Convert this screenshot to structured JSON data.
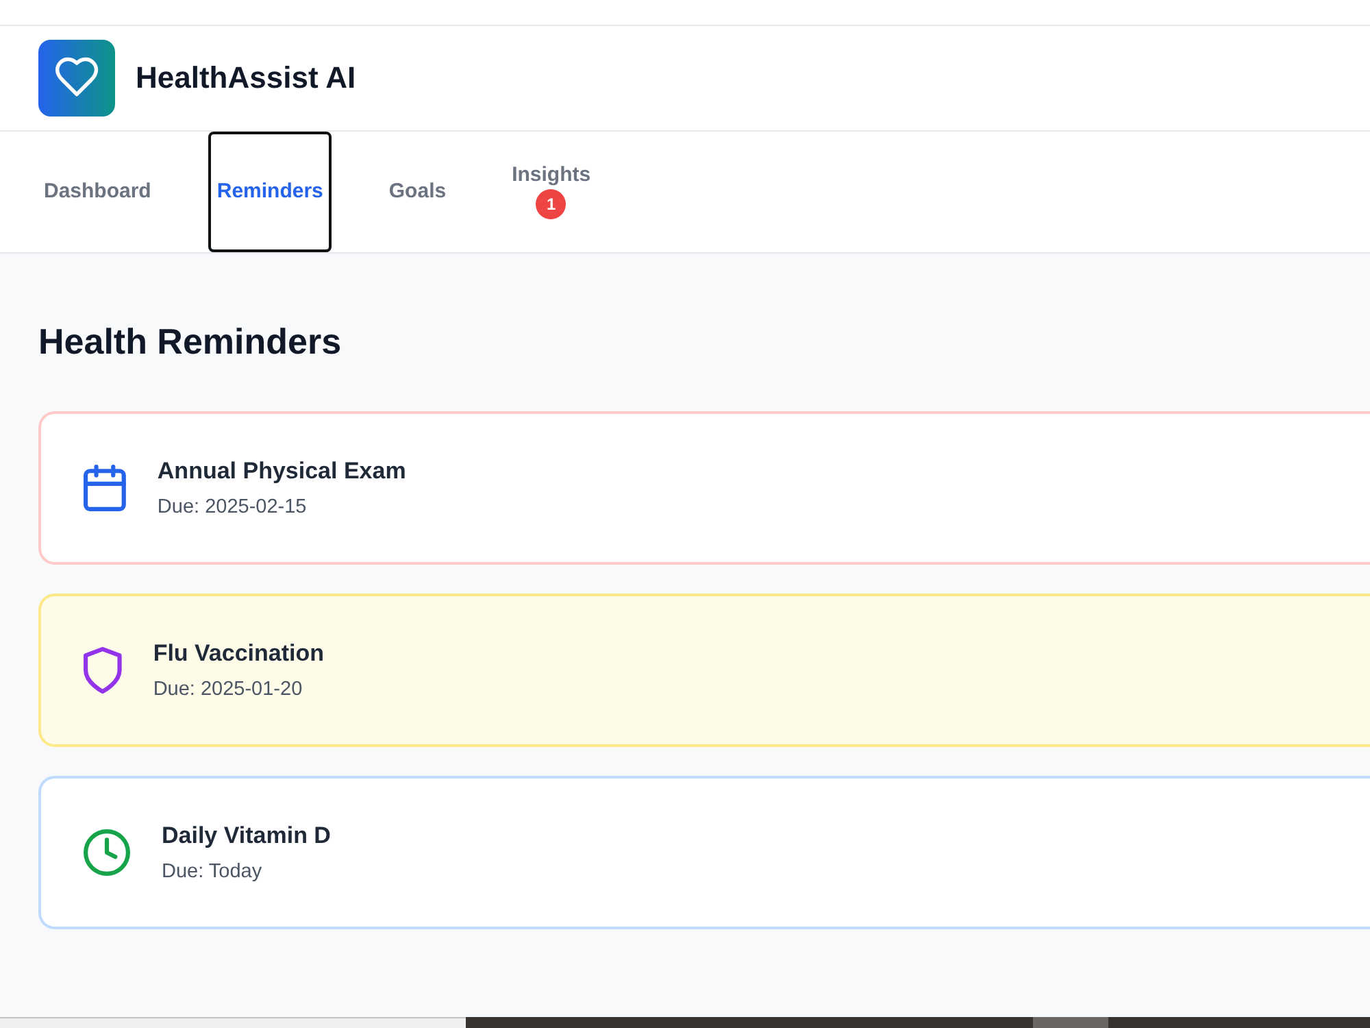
{
  "app": {
    "title": "HealthAssist AI"
  },
  "tabs": [
    {
      "label": "Dashboard",
      "selected": false
    },
    {
      "label": "Reminders",
      "selected": true
    },
    {
      "label": "Goals",
      "selected": false
    },
    {
      "label": "Insights",
      "selected": false,
      "badge": "1"
    }
  ],
  "reminders": {
    "heading": "Health Reminders",
    "items": [
      {
        "kind": "calendar",
        "title": "Annual Physical Exam",
        "due": "Due: 2025-02-15",
        "color": "#fecaca",
        "highlighted": false
      },
      {
        "kind": "shield",
        "title": "Flu Vaccination",
        "due": "Due: 2025-01-20",
        "color": "#fde98a",
        "highlighted": true
      },
      {
        "kind": "clock",
        "title": "Daily Vitamin D",
        "due": "Due: Today",
        "color": "#bfdbfe",
        "highlighted": false
      }
    ]
  }
}
